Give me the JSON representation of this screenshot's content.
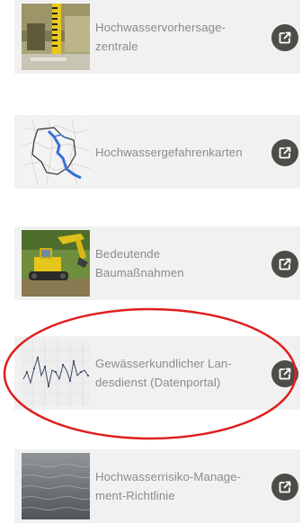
{
  "cards": [
    {
      "label": "Hochwasservorhersage-\nzentrale",
      "thumbnail": "water-gauge-photo",
      "link_icon": "external-link-icon"
    },
    {
      "label": "Hochwassergefahrenkarten",
      "thumbnail": "river-map",
      "link_icon": "external-link-icon"
    },
    {
      "label": "Bedeutende\nBaumaßnahmen",
      "thumbnail": "excavator-photo",
      "link_icon": "external-link-icon"
    },
    {
      "label": "Gewässerkundlicher Lan-\ndesdienst (Datenportal)",
      "thumbnail": "line-chart",
      "link_icon": "external-link-icon"
    },
    {
      "label": "Hochwasserrisiko-Manage-\nment-Richtlinie",
      "thumbnail": "water-surface-photo",
      "link_icon": "external-link-icon"
    }
  ],
  "highlighted_card": 3,
  "colors": {
    "card_background": "#f1f1f1",
    "label_text": "#8b8b8b",
    "button_background": "#4d4c46",
    "highlight_ellipse": "#e01e1e"
  }
}
